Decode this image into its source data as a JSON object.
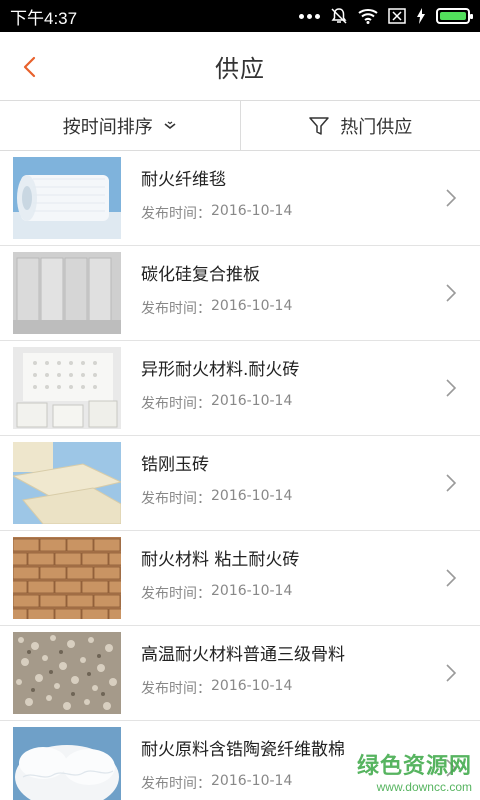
{
  "status_bar": {
    "time": "下午4:37"
  },
  "header": {
    "title": "供应"
  },
  "filters": {
    "sort_label": "按时间排序",
    "hot_label": "热门供应"
  },
  "list": {
    "date_prefix": "发布时间：",
    "items": [
      {
        "title": "耐火纤维毯",
        "date": "2016-10-14",
        "thumb": "ceramic-fiber-blanket"
      },
      {
        "title": "碳化硅复合推板",
        "date": "2016-10-14",
        "thumb": "silicon-carbide-plates"
      },
      {
        "title": "异形耐火材料.耐火砖",
        "date": "2016-10-14",
        "thumb": "shaped-refractory"
      },
      {
        "title": "锆刚玉砖",
        "date": "2016-10-14",
        "thumb": "zirconia-corundum-brick"
      },
      {
        "title": "耐火材料 粘土耐火砖",
        "date": "2016-10-14",
        "thumb": "clay-firebrick"
      },
      {
        "title": "高温耐火材料普通三级骨料",
        "date": "2016-10-14",
        "thumb": "aggregate"
      },
      {
        "title": "耐火原料含锆陶瓷纤维散棉",
        "date": "2016-10-14",
        "thumb": "fiber-bulk"
      }
    ]
  },
  "watermark": {
    "main": "绿色资源网",
    "sub": "www.downcc.com"
  },
  "colors": {
    "accent": "#e8612c",
    "watermark": "#3aa845",
    "battery": "#52e05c"
  }
}
